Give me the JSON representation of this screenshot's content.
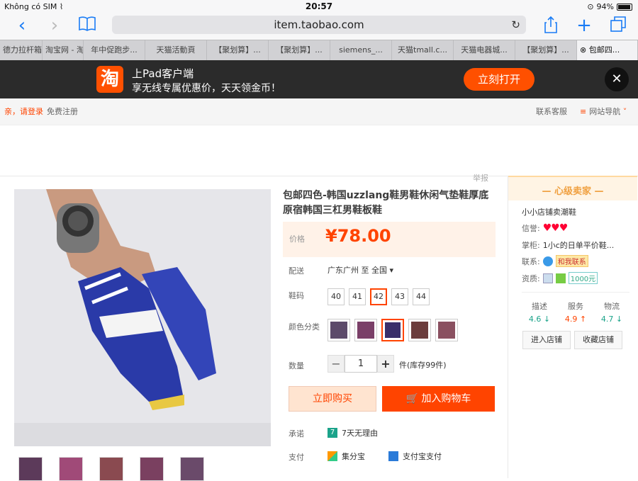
{
  "status_bar": {
    "carrier": "Không có SIM",
    "time": "20:57",
    "battery": "94%"
  },
  "browser": {
    "url": "item.taobao.com"
  },
  "tabs": [
    "德力拉杆箱",
    "淘宝网 - 淘",
    "年中促跑步...",
    "天猫活動頁",
    "【聚划算】...",
    "【聚划算】...",
    "siemens_...",
    "天猫tmall.c...",
    "天猫电器城...",
    "【聚划算】...",
    "包邮四..."
  ],
  "app_banner": {
    "logo": "淘",
    "title": "上Pad客户端",
    "subtitle": "享无线专属优惠价，天天领金币！",
    "open_label": "立刻打开",
    "close_label": "✕"
  },
  "site_nav": {
    "login": "亲，请登录",
    "register": "免费注册",
    "service": "联系客服",
    "site_nav": "网站导航"
  },
  "product": {
    "report": "举报",
    "title": "包邮四色-韩国uzzlang鞋男鞋休闲气垫鞋厚底原宿韩国三杠男鞋板鞋",
    "price_label": "价格",
    "price": "¥78.00",
    "shipping_label": "配送",
    "shipping_value": "广东广州 至",
    "shipping_region": "全国",
    "size_label": "鞋码",
    "sizes": [
      "40",
      "41",
      "42",
      "43",
      "44"
    ],
    "selected_size": "42",
    "color_label": "颜色分类",
    "colors": [
      "#5c4a6a",
      "#7a3f68",
      "#3a2f6a",
      "#6b3c3c",
      "#8a5060"
    ],
    "qty_label": "数量",
    "qty": "1",
    "qty_minus": "−",
    "qty_plus": "+",
    "stock": "件(库存99件)",
    "buy_now": "立即购买",
    "add_cart": "加入购物车",
    "promise_label": "承诺",
    "promise_value": "7天无理由",
    "pay_label": "支付",
    "pay_1": "集分宝",
    "pay_2": "支付宝支付"
  },
  "seller": {
    "header": "心级卖家",
    "shop_name": "小小店铺卖潮鞋",
    "credit_label": "信誉:",
    "credit_value": "♥♥♥",
    "keeper_label": "掌柜:",
    "keeper_value": "1小c的日单平价鞋...",
    "contact_label": "联系:",
    "contact_value": "和我联系",
    "qual_label": "资质:",
    "qual_value": "1000元",
    "scores": [
      {
        "label": "描述",
        "value": "4.6",
        "trend": "↓"
      },
      {
        "label": "服务",
        "value": "4.9",
        "trend": "↑"
      },
      {
        "label": "物流",
        "value": "4.7",
        "trend": "↓"
      }
    ],
    "enter_shop": "进入店铺",
    "fav_shop": "收藏店铺"
  },
  "colors": {
    "accent": "#ff4400",
    "score_down": "#1ba38a",
    "score_up": "#f40"
  }
}
